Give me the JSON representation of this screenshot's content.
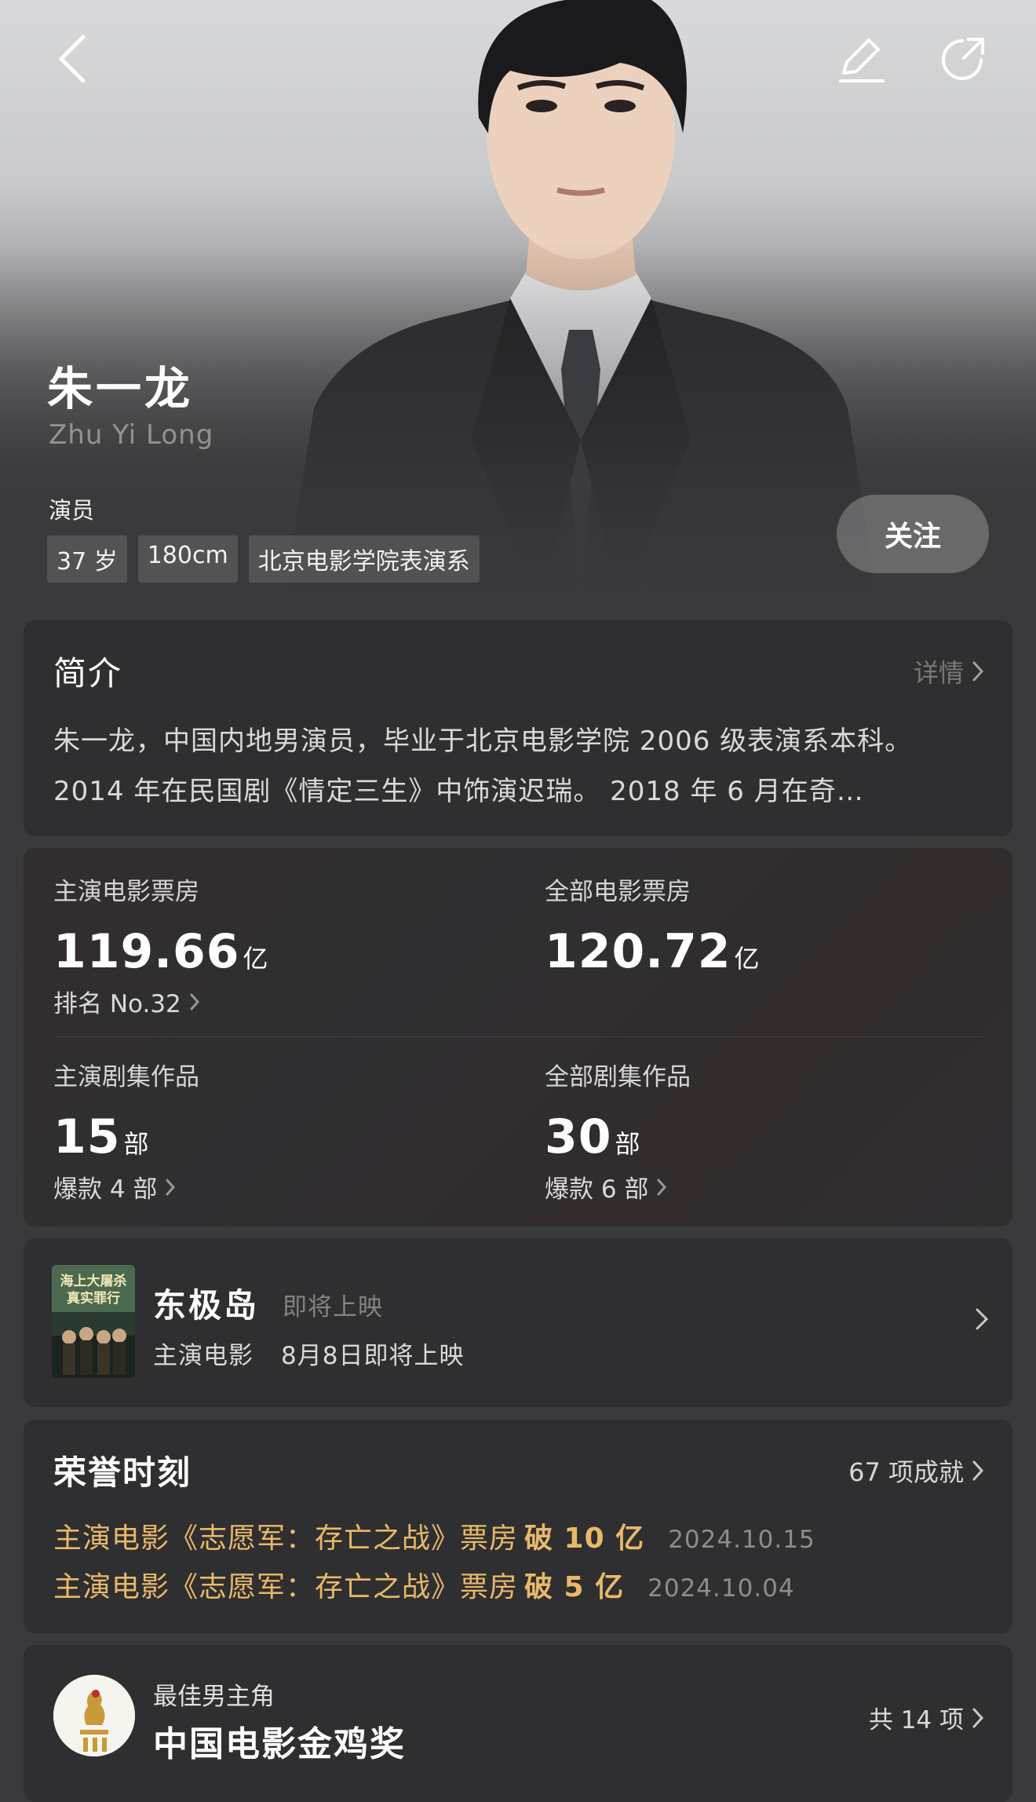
{
  "header": {
    "back_icon": "back-chevron-icon",
    "edit_icon": "pencil-icon",
    "share_icon": "share-icon"
  },
  "profile": {
    "name": "朱一龙",
    "pinyin": "Zhu Yi Long",
    "role": "演员",
    "tags": [
      "37 岁",
      "180cm",
      "北京电影学院表演系"
    ],
    "follow_label": "关注"
  },
  "intro": {
    "title": "简介",
    "more_label": "详情",
    "text": "朱一龙，中国内地男演员，毕业于北京电影学院 2006 级表演系本科。 2014 年在民国剧《情定三生》中饰演迟瑞。 2018 年 6 月在奇…"
  },
  "stats": {
    "lead_box_office": {
      "label": "主演电影票房",
      "value": "119.66",
      "unit": "亿",
      "sub": "排名 No.32"
    },
    "all_box_office": {
      "label": "全部电影票房",
      "value": "120.72",
      "unit": "亿"
    },
    "lead_series": {
      "label": "主演剧集作品",
      "value": "15",
      "unit": "部",
      "sub": "爆款 4 部"
    },
    "all_series": {
      "label": "全部剧集作品",
      "value": "30",
      "unit": "部",
      "sub": "爆款 6 部"
    }
  },
  "upcoming": {
    "poster_text": [
      "海上大屠杀",
      "真实罪行"
    ],
    "title": "东极岛",
    "status": "即将上映",
    "type": "主演电影",
    "date": "8月8日即将上映"
  },
  "honors": {
    "title": "荣誉时刻",
    "count_label": "67 项成就",
    "items": [
      {
        "text": "主演电影《志愿军：存亡之战》票房",
        "highlight": "破 10 亿",
        "date": "2024.10.15"
      },
      {
        "text": "主演电影《志愿军：存亡之战》票房",
        "highlight": "破 5 亿",
        "date": "2024.10.04"
      }
    ]
  },
  "award": {
    "category": "最佳男主角",
    "name": "中国电影金鸡奖",
    "count_label": "共 14 项",
    "logo_icon": "golden-rooster-logo-icon"
  },
  "colors": {
    "background": "#3a3a3c",
    "card": "#2f2f31",
    "honor_gold": "#e9b868"
  }
}
